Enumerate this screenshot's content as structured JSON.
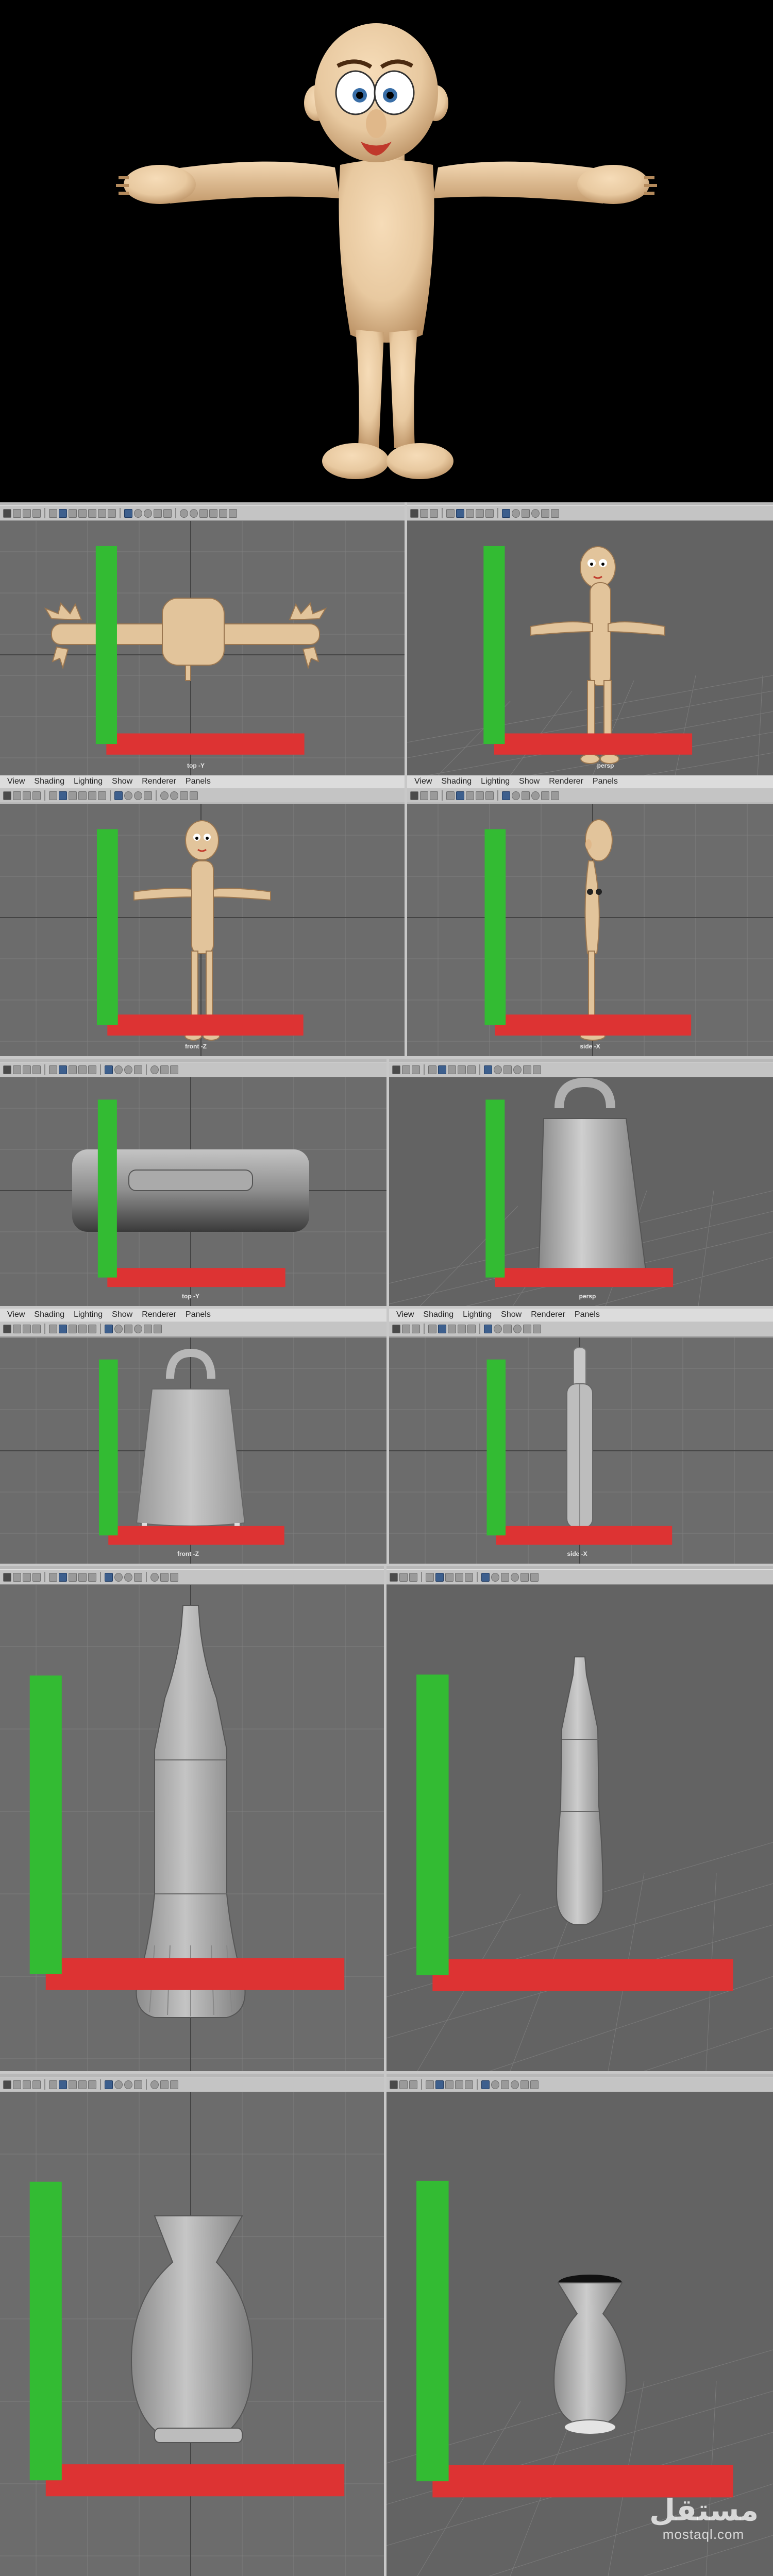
{
  "menus": [
    "View",
    "Shading",
    "Lighting",
    "Show",
    "Renderer",
    "Panels"
  ],
  "cameras": {
    "top": "top -Y",
    "persp": "persp",
    "front": "front -Z",
    "side": "side -X"
  },
  "watermark": {
    "arabic": "مستقل",
    "latin": "mostaql.com"
  },
  "colors": {
    "skin": "#e8c9a0",
    "viewport_grey": "#6c6c6c",
    "model_grey": "#a6a6a6",
    "hero_background": "#000000",
    "menubar": "#dcdcdc",
    "toolbar": "#c4c4c4"
  },
  "icons": [
    "select-tool-icon",
    "camera-icon",
    "grid-icon",
    "wireframe-icon",
    "smooth-shade-icon",
    "texture-icon",
    "light-icon",
    "isolate-icon"
  ]
}
